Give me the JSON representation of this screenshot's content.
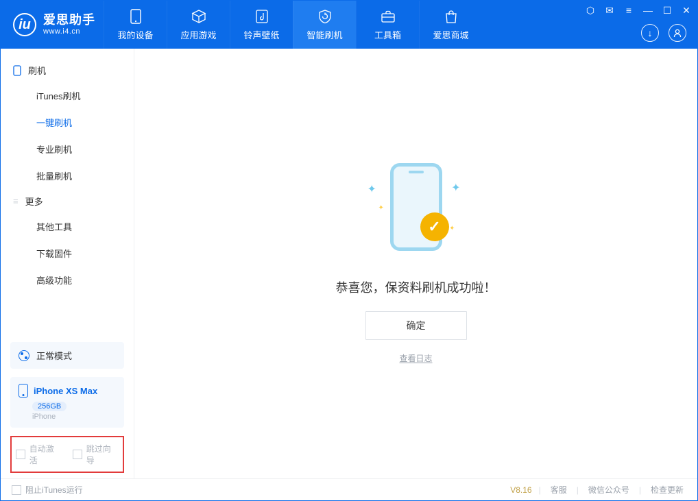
{
  "app": {
    "title": "爱思助手",
    "subtitle": "www.i4.cn",
    "logo_letter": "iu"
  },
  "tabs": {
    "device": "我的设备",
    "apps": "应用游戏",
    "ringtone": "铃声壁纸",
    "flash": "智能刷机",
    "tools": "工具箱",
    "store": "爱思商城"
  },
  "sidebar": {
    "flash_section": "刷机",
    "items": {
      "itunes": "iTunes刷机",
      "oneclick": "一键刷机",
      "pro": "专业刷机",
      "batch": "批量刷机"
    },
    "more_section": "更多",
    "more": {
      "other": "其他工具",
      "firmware": "下载固件",
      "advanced": "高级功能"
    }
  },
  "status": {
    "mode": "正常模式"
  },
  "device": {
    "name": "iPhone XS Max",
    "capacity": "256GB",
    "type": "iPhone"
  },
  "checks": {
    "auto_activate": "自动激活",
    "skip_guide": "跳过向导"
  },
  "main": {
    "success": "恭喜您，保资料刷机成功啦！",
    "ok": "确定",
    "view_log": "查看日志"
  },
  "footer": {
    "block_itunes": "阻止iTunes运行",
    "version": "V8.16",
    "support": "客服",
    "wechat": "微信公众号",
    "update": "检查更新"
  }
}
